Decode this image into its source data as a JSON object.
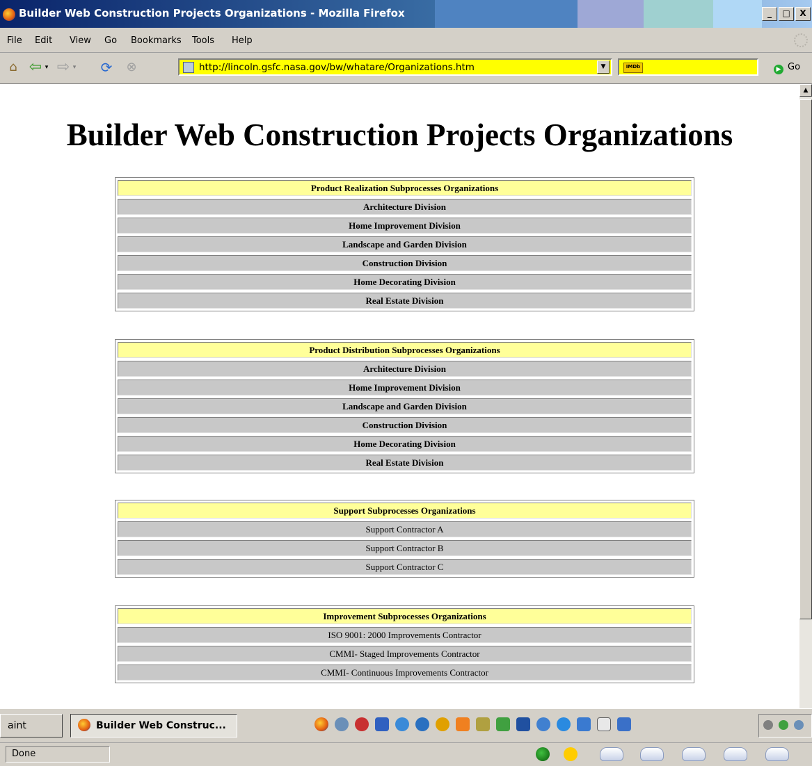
{
  "window": {
    "title": "Builder Web Construction Projects Organizations - Mozilla Firefox",
    "min_glyph": "_",
    "max_glyph": "□",
    "close_glyph": "X"
  },
  "menu": {
    "file": "File",
    "edit": "Edit",
    "view": "View",
    "go": "Go",
    "bookmarks": "Bookmarks",
    "tools": "Tools",
    "help": "Help"
  },
  "navbar": {
    "url": "http://lincoln.gsfc.nasa.gov/bw/whatare/Organizations.htm",
    "search_engine": "IMDb",
    "search_value": "",
    "go_label": "Go"
  },
  "page": {
    "title": "Builder Web Construction Projects Organizations",
    "tables": [
      {
        "header": "Product Realization Subprocesses Organizations",
        "items": [
          "Architecture Division",
          "Home Improvement Division",
          "Landscape and Garden Division",
          "Construction Division",
          "Home Decorating Division",
          "Real Estate Division"
        ]
      },
      {
        "header": "Product Distribution Subprocesses Organizations",
        "items": [
          "Architecture Division",
          "Home Improvement Division",
          "Landscape and Garden Division",
          "Construction Division",
          "Home Decorating Division",
          "Real Estate Division"
        ]
      },
      {
        "header": "Support Subprocesses Organizations",
        "items": [
          "Support Contractor A",
          "Support Contractor B",
          "Support Contractor C"
        ]
      },
      {
        "header": "Improvement Subprocesses Organizations",
        "items": [
          "ISO 9001: 2000 Improvements Contractor",
          "CMMI- Staged Improvements Contractor",
          "CMMI- Continuous Improvements Contractor"
        ]
      }
    ]
  },
  "taskbar": {
    "paint_label": "aint",
    "firefox_label": "Builder Web Construc..."
  },
  "statusbar": {
    "text": "Done"
  },
  "colors": {
    "header_row": "#ffff99",
    "item_row": "#c8c8c8",
    "url_bar": "#ffff00"
  },
  "icons": {
    "nav": [
      "home-icon",
      "back-icon",
      "forward-icon",
      "reload-icon",
      "stop-icon"
    ],
    "quicklaunch": [
      "firefox-icon",
      "app-icon",
      "app-icon",
      "app-icon",
      "ie-icon",
      "app-icon",
      "app-icon",
      "app-icon",
      "app-icon",
      "app-icon",
      "app-icon",
      "app-icon",
      "app-icon",
      "app-icon",
      "app-icon",
      "app-icon"
    ],
    "tray": [
      "tray-icon",
      "tray-icon",
      "tray-icon"
    ],
    "status": [
      "globe-icon",
      "sun-icon",
      "cloud-icon",
      "cloud-icon",
      "cloud-icon",
      "cloud-icon",
      "cloud-icon"
    ]
  }
}
